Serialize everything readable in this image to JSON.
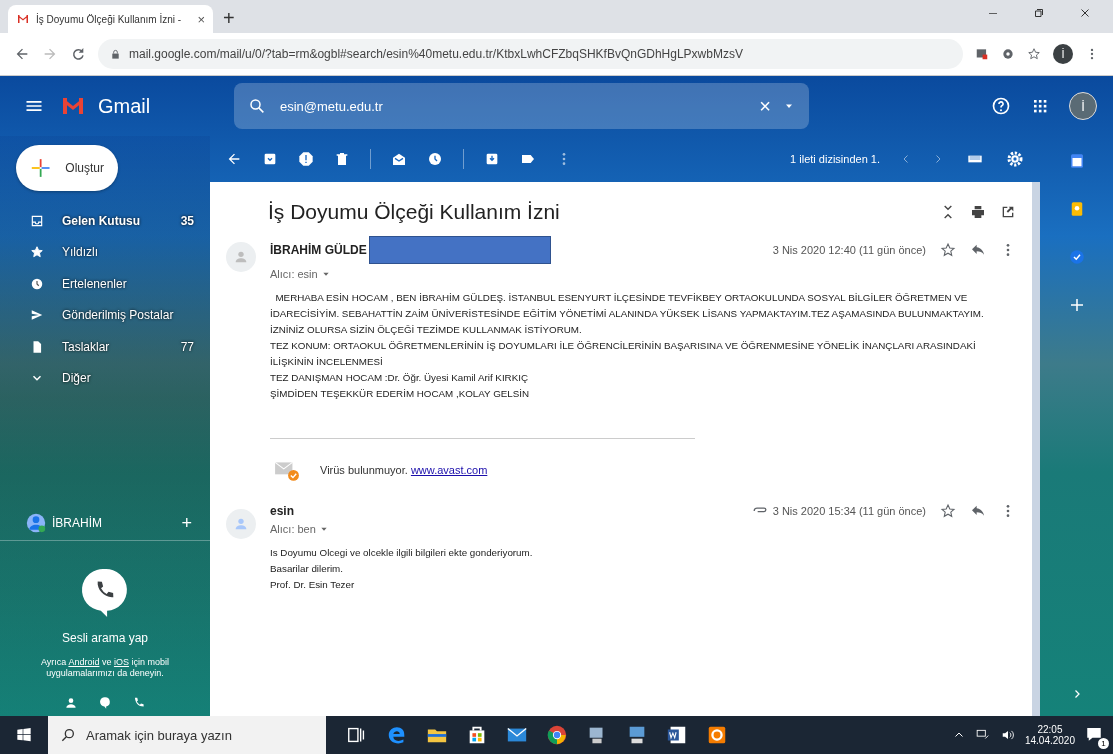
{
  "browser": {
    "tab_title": "İş Doyumu Ölçeği Kullanım İzni -",
    "tab_close": "×",
    "new_tab": "+",
    "url": "mail.google.com/mail/u/0/?tab=rm&ogbl#search/esin%40metu.edu.tr/KtbxLwhCFZbqSHKfBvQnGDhHgLPxwbMzsV",
    "profile": "İ"
  },
  "header": {
    "app_name": "Gmail",
    "search": {
      "value": "esin@metu.edu.tr"
    },
    "search_clear": "×",
    "account_initial": "İ"
  },
  "sidebar": {
    "compose": "Oluştur",
    "items": [
      {
        "kind": "inbox",
        "label": "Gelen Kutusu",
        "count": "35",
        "unread": true
      },
      {
        "kind": "star",
        "label": "Yıldızlı",
        "unread": false
      },
      {
        "kind": "snooze",
        "label": "Ertelenenler",
        "unread": false
      },
      {
        "kind": "sent",
        "label": "Gönderilmiş Postalar",
        "unread": false
      },
      {
        "kind": "draft",
        "label": "Taslaklar",
        "count": "77",
        "unread": false
      },
      {
        "kind": "more",
        "label": "Diğer",
        "unread": false
      }
    ],
    "hangouts": {
      "user": "İBRAHİM",
      "add": "+",
      "call_label": "Sesli arama yap",
      "promo_before": "Ayrıca ",
      "promo_link1": "Android",
      "promo_mid": " ve ",
      "promo_link2": "iOS",
      "promo_after": " için mobil uygulamalarımızı da deneyin."
    }
  },
  "toolbar": {
    "pager": "1 ileti dizisinden 1."
  },
  "thread": {
    "subject": "İş Doyumu Ölçeği Kullanım İzni",
    "messages": [
      {
        "sender": "İBRAHİM GÜLDE",
        "redacted": true,
        "recipient": "Alıcı: esin",
        "date": "3 Nis 2020 12:40 (11 gün önce)",
        "attachment": false,
        "body": [
          "  MERHABA ESİN HOCAM , BEN İBRAHİM GÜLDEŞ. İSTANBUL ESENYURT İLÇESİNDE TEVFİKBEY ORTAOKULUNDA SOSYAL BİLGİLER ÖĞRETMEN VE",
          "İDARECİSİYİM. SEBAHATTİN ZAİM ÜNİVERİSTESİNDE EĞİTİM YÖNETİMİ ALANINDA YÜKSEK LİSANS YAPMAKTAYIM.TEZ AŞAMASINDA BULUNMAKTAYIM.",
          "İZNİNİZ OLURSA SİZİN ÖLÇEĞİ TEZİMDE KULLANMAK İSTİYORUM.",
          "TEZ KONUM: ORTAOKUL ÖĞRETMENLERİNİN İŞ DOYUMLARI İLE ÖĞRENCİLERİNİN BAŞARISINA VE ÖĞRENMESİNE YÖNELİK İNANÇLARI ARASINDAKİ",
          "İLİŞKİNİN İNCELENMESİ",
          "TEZ DANIŞMAN HOCAM :Dr. Öğr. Üyesi Kamil Arif KIRKIÇ",
          "ŞİMDİDEN TEŞEKKÜR EDERİM HOCAM ,KOLAY GELSİN"
        ],
        "signature": {
          "text": "Virüs bulunmuyor. ",
          "link": "www.avast.com"
        }
      },
      {
        "sender": "esin",
        "redacted": false,
        "recipient": "Alıcı: ben",
        "date": "3 Nis 2020 15:34 (11 gün önce)",
        "attachment": true,
        "body": [
          "Is Doyumu Olcegi ve olcekle ilgili bilgileri ekte gonderiyorum.",
          "Basarilar dilerim.",
          "Prof. Dr. Esin Tezer"
        ]
      }
    ]
  },
  "taskbar": {
    "search_placeholder": "Aramak için buraya yazın",
    "time": "22:05",
    "date": "14.04.2020",
    "notifications": "1"
  }
}
